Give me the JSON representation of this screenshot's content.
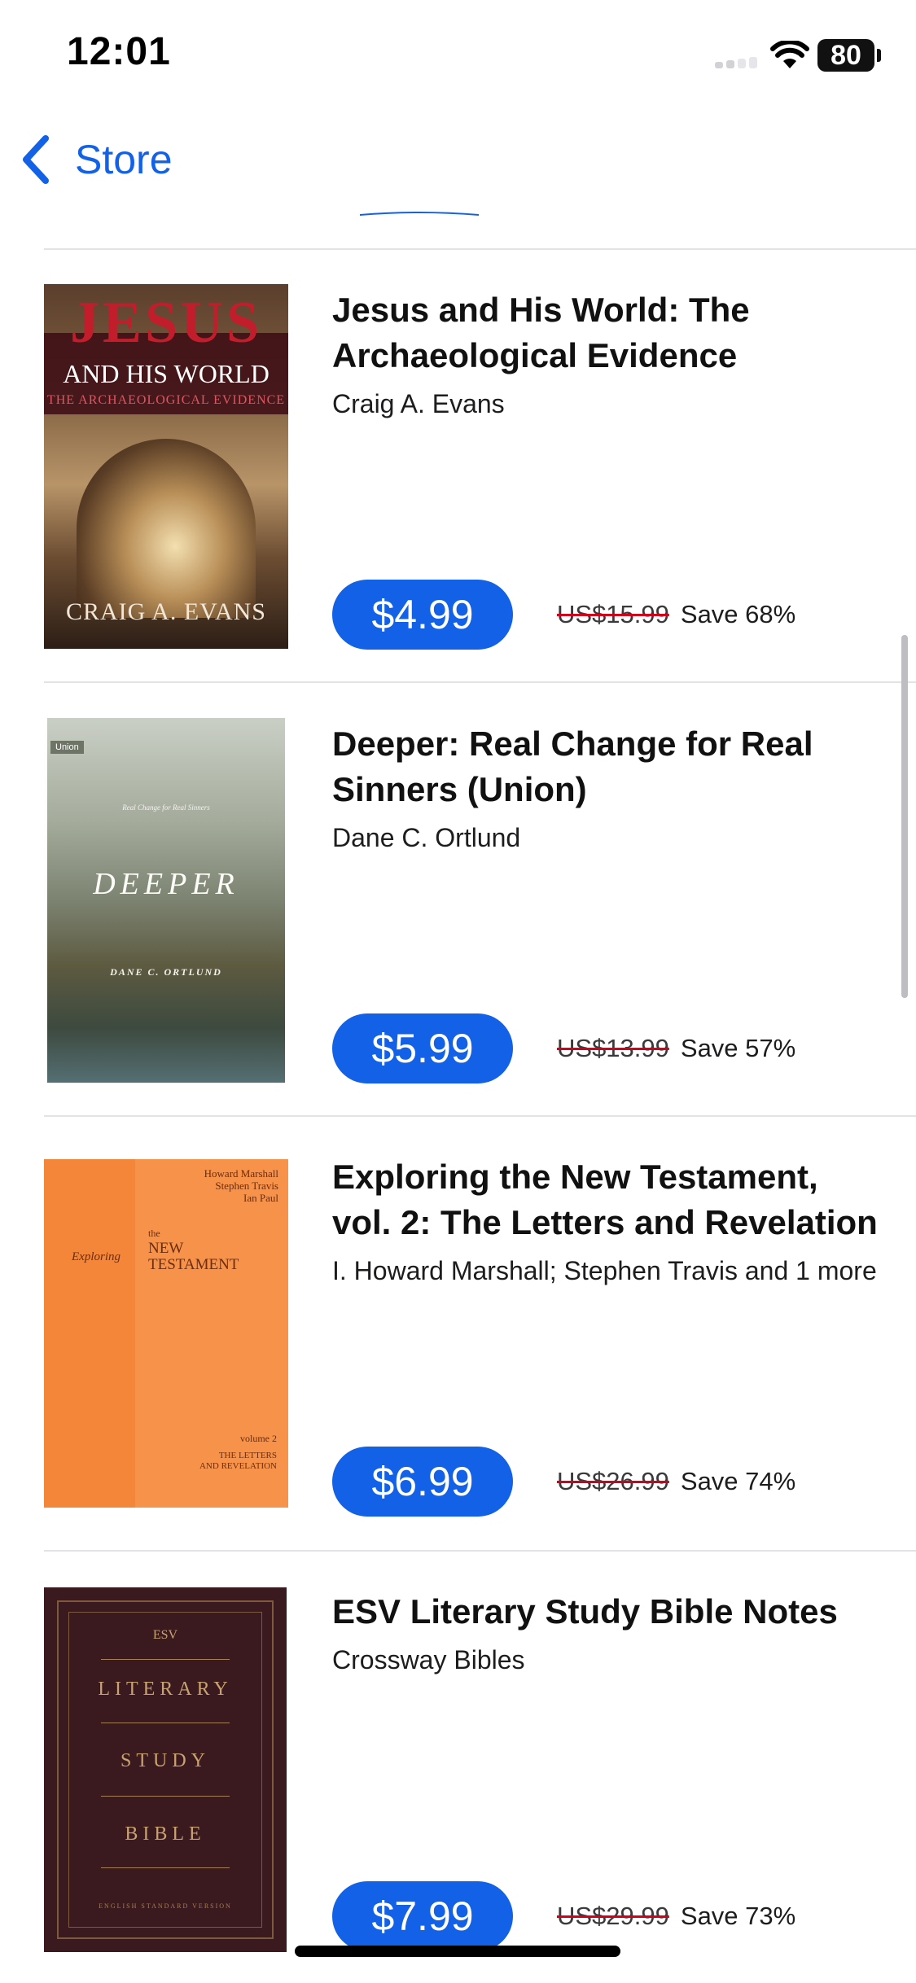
{
  "status_bar": {
    "time": "12:01",
    "battery": "80"
  },
  "nav": {
    "back_label": "Store"
  },
  "books": [
    {
      "title": "Jesus and His World: The Archaeological Evidence",
      "author": "Craig A. Evans",
      "price": "$4.99",
      "original_price": "US$15.99",
      "save": "Save 68%",
      "cover": {
        "line1": "JESUS",
        "line2": "AND HIS WORLD",
        "line3": "THE ARCHAEOLOGICAL EVIDENCE",
        "author": "CRAIG A. EVANS"
      }
    },
    {
      "title": "Deeper: Real Change for Real Sinners (Union)",
      "author": "Dane C. Ortlund",
      "price": "$5.99",
      "original_price": "US$13.99",
      "save": "Save 57%",
      "cover": {
        "tag": "Union",
        "subtitle": "Real Change for Real Sinners",
        "title": "DEEPER",
        "author": "DANE C. ORTLUND"
      }
    },
    {
      "title": "Exploring the New Testament, vol. 2: The Letters and Revelation",
      "author": "I. Howard Marshall; Stephen Travis and 1 more",
      "price": "$6.99",
      "original_price": "US$26.99",
      "save": "Save 74%",
      "cover": {
        "authors": [
          "Howard Marshall",
          "Stephen Travis",
          "Ian Paul"
        ],
        "exploring": "Exploring",
        "the": "the",
        "title_lines": [
          "NEW",
          "TESTAMENT"
        ],
        "volume": "volume 2",
        "subtitle_lines": [
          "THE LETTERS",
          "AND REVELATION"
        ]
      }
    },
    {
      "title": "ESV Literary Study Bible Notes",
      "author": "Crossway Bibles",
      "price": "$7.99",
      "original_price": "US$29.99",
      "save": "Save 73%",
      "cover": {
        "logo": "ESV",
        "words": [
          "LITERARY",
          "STUDY",
          "BIBLE"
        ],
        "footer": "ENGLISH STANDARD VERSION"
      }
    }
  ],
  "colors": {
    "accent": "#1261e6",
    "strike": "#d0021b",
    "divider": "#e3e3e6"
  }
}
